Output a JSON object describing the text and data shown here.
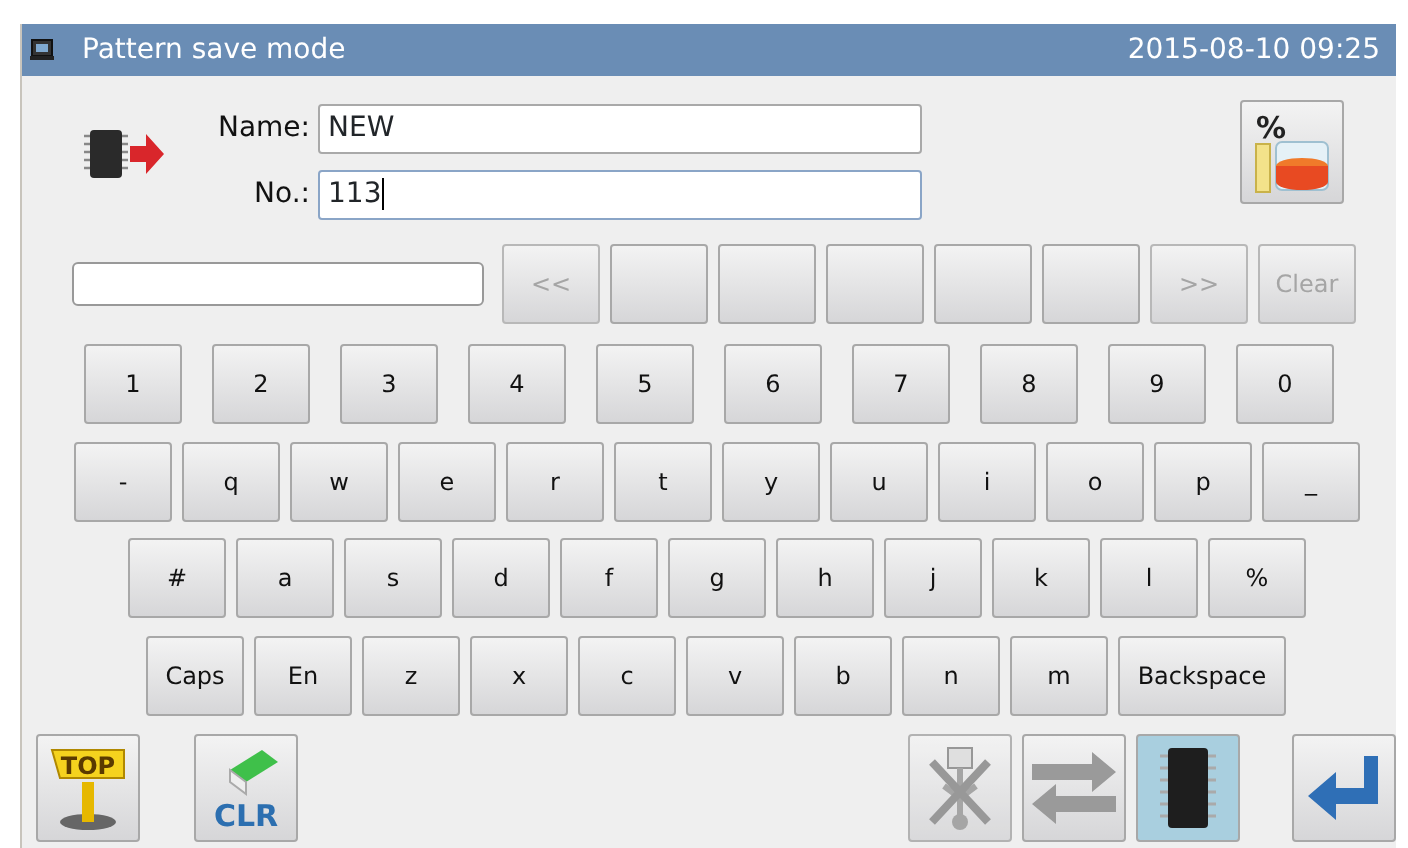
{
  "window": {
    "title": "Pattern save mode",
    "datetime": "2015-08-10 09:25"
  },
  "fields": [
    {
      "label": "Name:",
      "value": "NEW",
      "focused": false
    },
    {
      "label": "No.:",
      "value": "113",
      "focused": true
    }
  ],
  "stats_button": {
    "label": "%"
  },
  "candidate_bar": {
    "buttons": [
      {
        "label": "<<",
        "disabled": true
      },
      {
        "disabled": false
      },
      {
        "disabled": false
      },
      {
        "disabled": false
      },
      {
        "disabled": false
      },
      {
        "disabled": false
      },
      {
        "label": ">>",
        "disabled": true
      },
      {
        "label": "Clear",
        "disabled": true
      }
    ]
  },
  "keyboard": [
    [
      "1",
      "2",
      "3",
      "4",
      "5",
      "6",
      "7",
      "8",
      "9",
      "0"
    ],
    [
      "-",
      "q",
      "w",
      "e",
      "r",
      "t",
      "y",
      "u",
      "i",
      "o",
      "p",
      "_"
    ],
    [
      "#",
      "a",
      "s",
      "d",
      "f",
      "g",
      "h",
      "j",
      "k",
      "l",
      "%"
    ],
    [
      "Caps",
      "En",
      "z",
      "x",
      "c",
      "v",
      "b",
      "n",
      "m",
      "Backspace"
    ]
  ],
  "toolbar": [
    {
      "kind": "top",
      "label": "TOP",
      "disabled": false,
      "selected": false
    },
    {
      "kind": "clr",
      "label": "CLR",
      "disabled": false,
      "selected": false
    },
    {
      "kind": "gap"
    },
    {
      "kind": "usb",
      "disabled": true,
      "selected": false
    },
    {
      "kind": "swap",
      "disabled": false,
      "selected": false
    },
    {
      "kind": "memory",
      "disabled": false,
      "selected": true
    },
    {
      "kind": "enter",
      "disabled": false,
      "selected": false
    }
  ]
}
